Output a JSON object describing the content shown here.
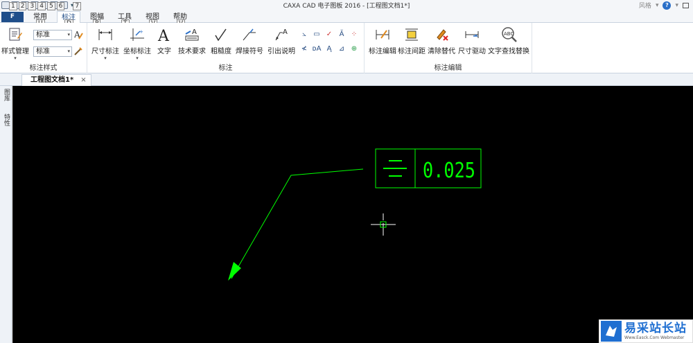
{
  "window": {
    "title": "CAXA CAD 电子图板 2016 - [工程图文档1*]",
    "style_label": "风格",
    "help_label": "?"
  },
  "keytips_top": [
    "1",
    "2",
    "3",
    "4",
    "5",
    "6",
    "7"
  ],
  "file_button": "F",
  "tabs": [
    {
      "label": "常用",
      "keytip": "U"
    },
    {
      "label": "标注",
      "keytip": "D"
    },
    {
      "label": "图幅",
      "keytip": "P"
    },
    {
      "label": "工具",
      "keytip": "T"
    },
    {
      "label": "视图",
      "keytip": "V"
    },
    {
      "label": "帮助",
      "keytip": "V"
    }
  ],
  "ribbon": {
    "style_group": {
      "label": "标注样式",
      "manage_button": "样式管理",
      "dim_style_value": "标准",
      "text_style_value": "标准"
    },
    "annotate_group": {
      "label": "标注",
      "buttons": [
        "尺寸标注",
        "坐标标注",
        "文字",
        "技术要求",
        "粗糙度",
        "焊接符号",
        "引出说明"
      ]
    },
    "edit_group": {
      "label": "标注编辑",
      "buttons": [
        "标注编辑",
        "标注间距",
        "清除替代",
        "尺寸驱动",
        "文字查找替换"
      ]
    }
  },
  "document": {
    "tab_title": "工程图文档1*",
    "close_label": "×"
  },
  "side_panel": {
    "tabs": [
      "图库",
      "特性"
    ]
  },
  "drawing": {
    "tolerance_value": "0.025",
    "symbol": "symmetry",
    "color": "#00ff00",
    "background": "#000000"
  },
  "watermark": {
    "main": "易采站长站",
    "sub": "Www.Easck.Com  Webmaster"
  }
}
